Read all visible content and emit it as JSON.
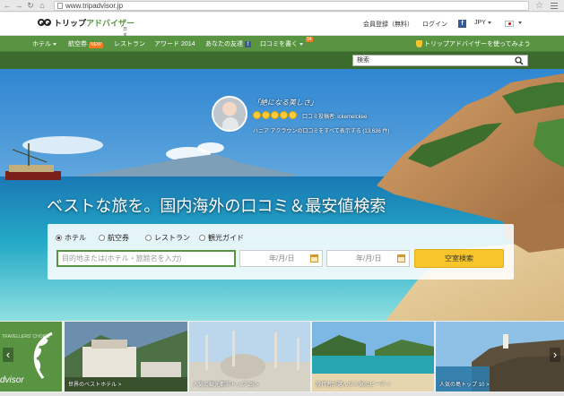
{
  "browser": {
    "url": "www.tripadvisor.jp"
  },
  "header": {
    "logo_text": "トリップ",
    "logo_accent": "アドバイザー",
    "logo_sub": "日本",
    "register": "会員登録（無料）",
    "login": "ログイン",
    "currency": "JPY"
  },
  "nav": {
    "hotels": "ホテル",
    "flights": "航空券",
    "flights_badge": "NEW",
    "restaurants": "レストラン",
    "awards": "アワード 2014",
    "friends": "あなたの友達",
    "write_review": "口コミを書く",
    "review_count": "34",
    "tryout": "トリップアドバイザーを使ってみよう"
  },
  "search": {
    "placeholder": "検索"
  },
  "hero": {
    "quote": "「絶になる美しさ」",
    "reviewer": "口コミ投稿者: lckemelckee",
    "see_all": "ハニア アクラウンの口コミをすべて表示する (13,636 件)",
    "tagline": "ベストな旅を。国内海外の口コミ＆最安値検索"
  },
  "booking": {
    "radio_hotel": "ホテル",
    "radio_flight": "航空券",
    "radio_restaurant": "レストラン",
    "radio_sightseeing": "観光ガイド",
    "destination_placeholder": "目的地または(ホテル・旅館名を入力)",
    "checkin": "年/月/日",
    "checkout": "年/月/日",
    "search_button": "空室検索"
  },
  "thumbnails": [
    {
      "label": "世界のベストホテル >"
    },
    {
      "label": "人気の観光都市トップ 25 >"
    },
    {
      "label": "旅行者が選んだ人気のビーチ >"
    },
    {
      "label": "人気の島トップ 10 >"
    }
  ],
  "award_card": {
    "brand": "dvisor",
    "small": "TRAVELLERS' CHOICE"
  },
  "colors": {
    "brand_green": "#589442",
    "button_yellow": "#f8c62c",
    "badge_orange": "#f47a1f"
  }
}
